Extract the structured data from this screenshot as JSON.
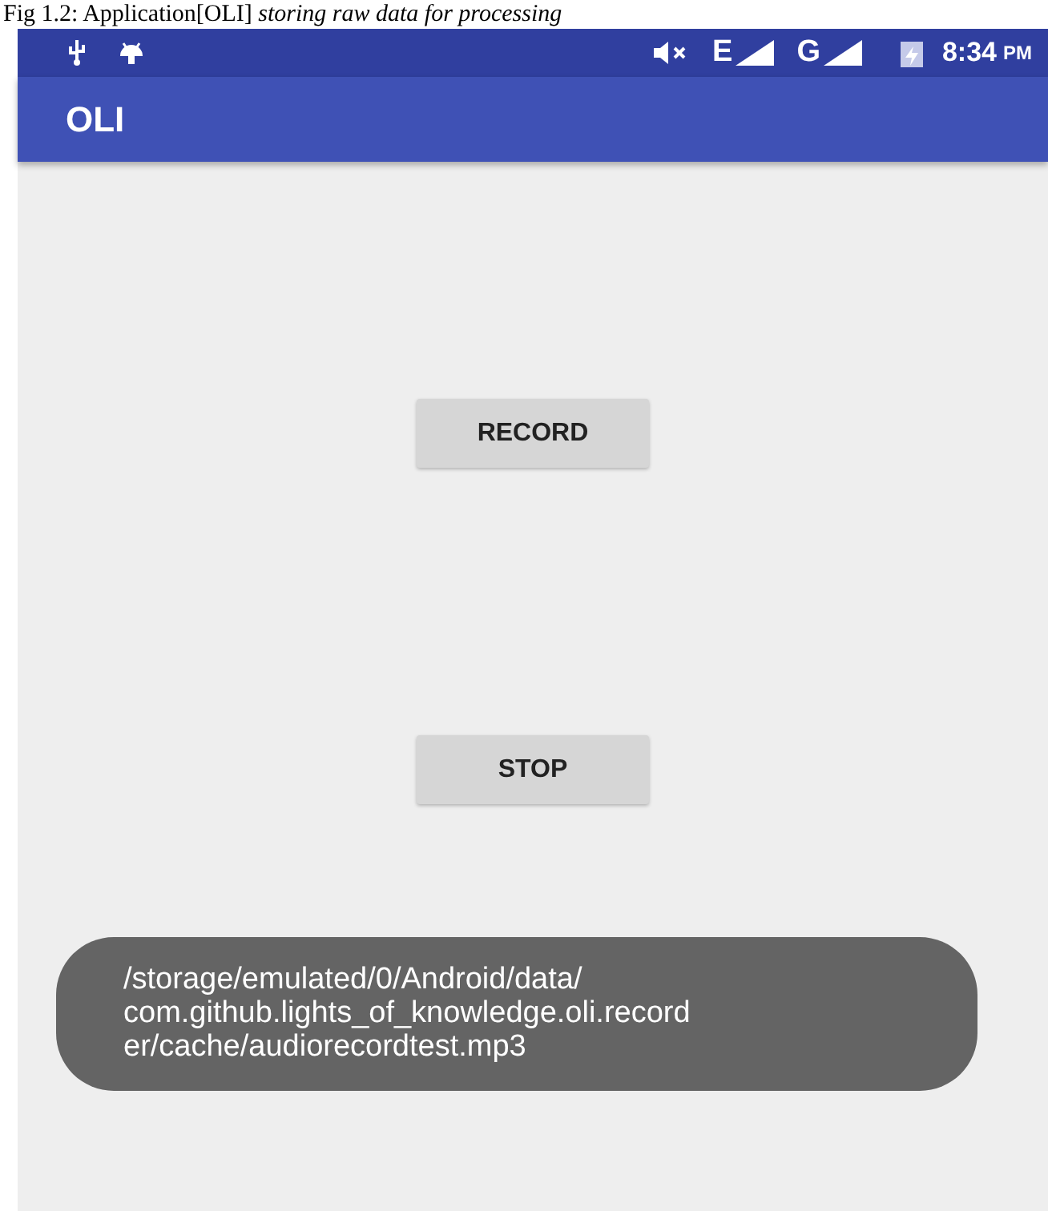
{
  "caption": "Fig 1.2: Application[OLI] *storing raw data for processing*",
  "status_bar": {
    "network_1": "E",
    "network_2": "G",
    "time": "8:34",
    "time_suffix": "PM"
  },
  "app_bar": {
    "title": "OLI"
  },
  "buttons": [
    {
      "label": "RECORD"
    },
    {
      "label": "STOP"
    }
  ],
  "toast": {
    "text": "/storage/emulated/0/Android/data/\ncom.github.lights_of_knowledge.oli.record\ner/cache/audiorecordtest.mp3"
  }
}
